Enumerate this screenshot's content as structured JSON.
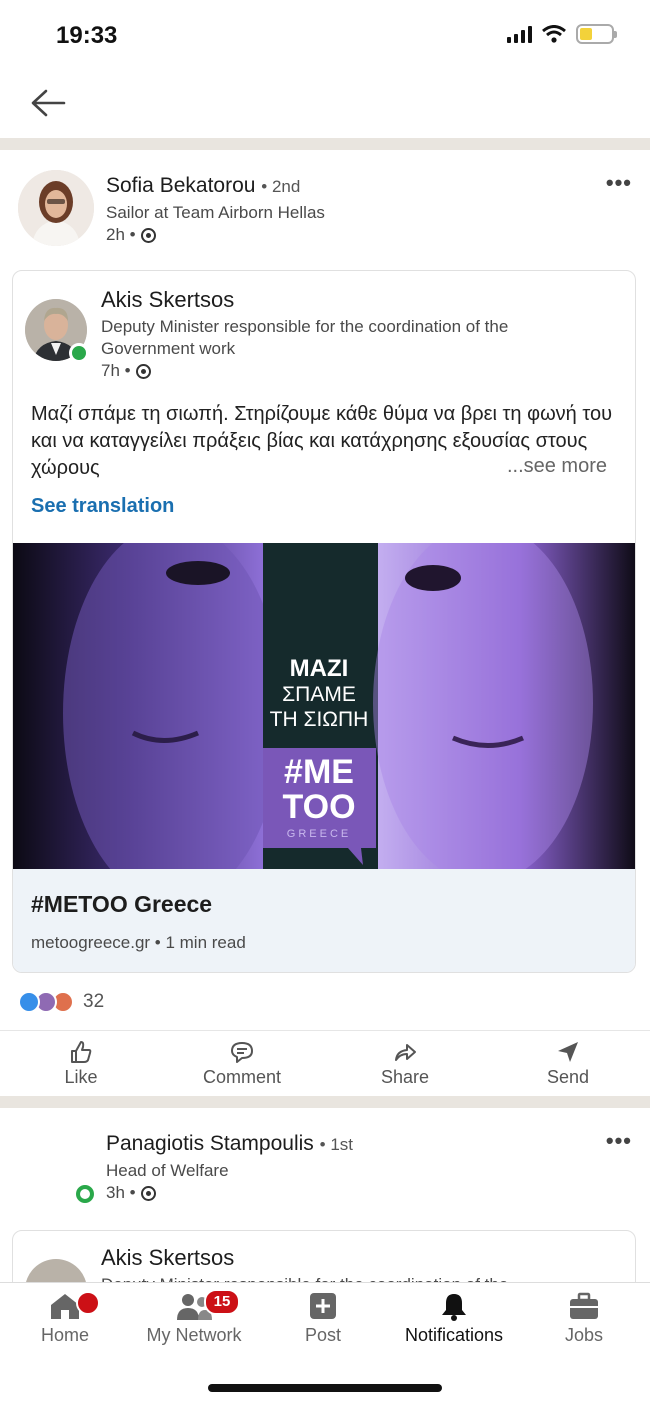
{
  "status_bar": {
    "time": "19:33"
  },
  "post": {
    "author": {
      "name": "Sofia Bekatorou",
      "degree": "• 2nd",
      "headline": "Sailor at Team Airborn Hellas",
      "time": "2h •"
    },
    "shared": {
      "author": {
        "name": "Akis Skertsos",
        "headline_line1": "Deputy Minister responsible for the coordination of the",
        "headline_line2": "Government work",
        "time": "7h •"
      },
      "text": "Μαζί σπάμε τη σιωπή. Στηρίζουμε κάθε θύμα να βρει τη φωνή του και να καταγγείλει πράξεις βίας και κατάχρησης εξουσίας στους χώρους",
      "see_more": "...see more",
      "see_translation": "See translation",
      "image_text": {
        "line1": "MAZI",
        "line2": "ΣΠΑΜΕ",
        "line3": "ΤΗ ΣΙΩΠΗ",
        "tag1": "#ME",
        "tag2": "TOO",
        "tag3": "GREECE"
      },
      "link": {
        "title": "#METOO Greece",
        "subtitle": "metoogreece.gr • 1 min read"
      }
    },
    "reactions": {
      "count": "32",
      "colors": [
        "#378fe9",
        "#8f6ab3",
        "#df704d"
      ]
    },
    "actions": {
      "like": "Like",
      "comment": "Comment",
      "share": "Share",
      "send": "Send"
    }
  },
  "next_post": {
    "author": {
      "name": "Panagiotis Stampoulis",
      "degree": "• 1st",
      "headline": "Head of Welfare",
      "time": "3h •"
    },
    "shared_author": {
      "name": "Akis Skertsos",
      "headline": "Deputy Minister responsible for the coordination of the"
    }
  },
  "bottom_nav": {
    "home": "Home",
    "network": "My Network",
    "network_badge": "15",
    "post": "Post",
    "notifications": "Notifications",
    "jobs": "Jobs"
  },
  "colors": {
    "accent": "#1a6fb0",
    "badge": "#cc1016",
    "online": "#2aa84a",
    "purple": "#7a57b8"
  }
}
